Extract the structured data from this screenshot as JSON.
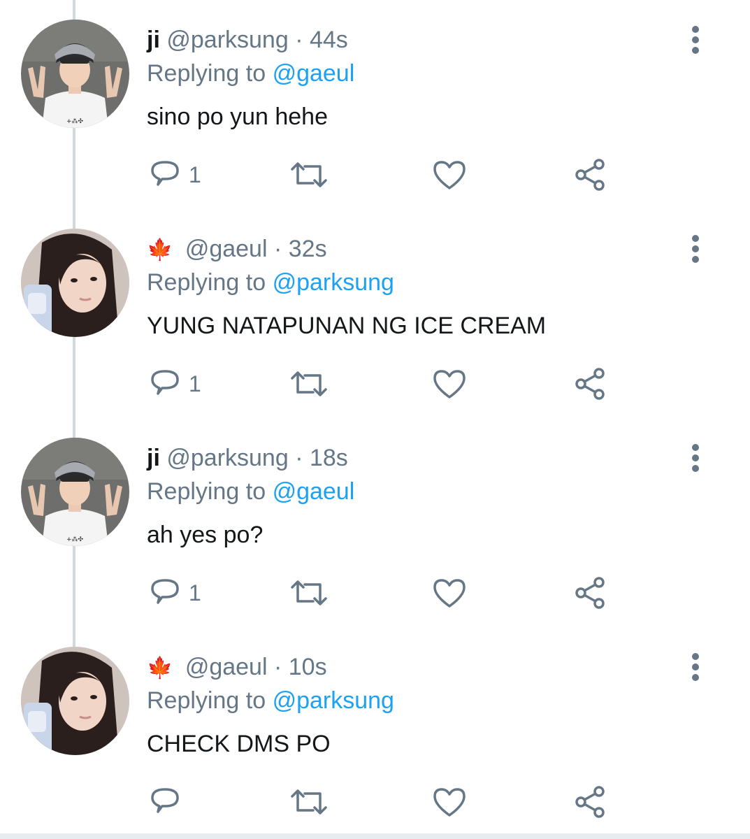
{
  "tweets": [
    {
      "display_name": "ji",
      "handle": "@parksung",
      "separator": "·",
      "time": "44s",
      "replying_prefix": "Replying to",
      "replying_to": "@gaeul",
      "text": "sino po yun hehe",
      "reply_count": "1",
      "avatar": "boy-peace-sign"
    },
    {
      "display_name": "🍁",
      "handle": "@gaeul",
      "separator": "·",
      "time": "32s",
      "replying_prefix": "Replying to",
      "replying_to": "@parksung",
      "text": "YUNG NATAPUNAN NG ICE CREAM",
      "reply_count": "1",
      "avatar": "girl-selfie"
    },
    {
      "display_name": "ji",
      "handle": "@parksung",
      "separator": "·",
      "time": "18s",
      "replying_prefix": "Replying to",
      "replying_to": "@gaeul",
      "text": "ah yes po?",
      "reply_count": "1",
      "avatar": "boy-peace-sign"
    },
    {
      "display_name": "🍁",
      "handle": "@gaeul",
      "separator": "·",
      "time": "10s",
      "replying_prefix": "Replying to",
      "replying_to": "@parksung",
      "text": "CHECK DMS PO",
      "reply_count": "",
      "avatar": "girl-selfie"
    }
  ],
  "icons": {
    "reply": "reply-icon",
    "retweet": "retweet-icon",
    "like": "like-icon",
    "share": "share-icon",
    "more": "more-vertical-icon"
  },
  "colors": {
    "icon": "#657786",
    "mention": "#1da1f2",
    "text": "#14171a",
    "thread_line": "#cfd9de"
  }
}
